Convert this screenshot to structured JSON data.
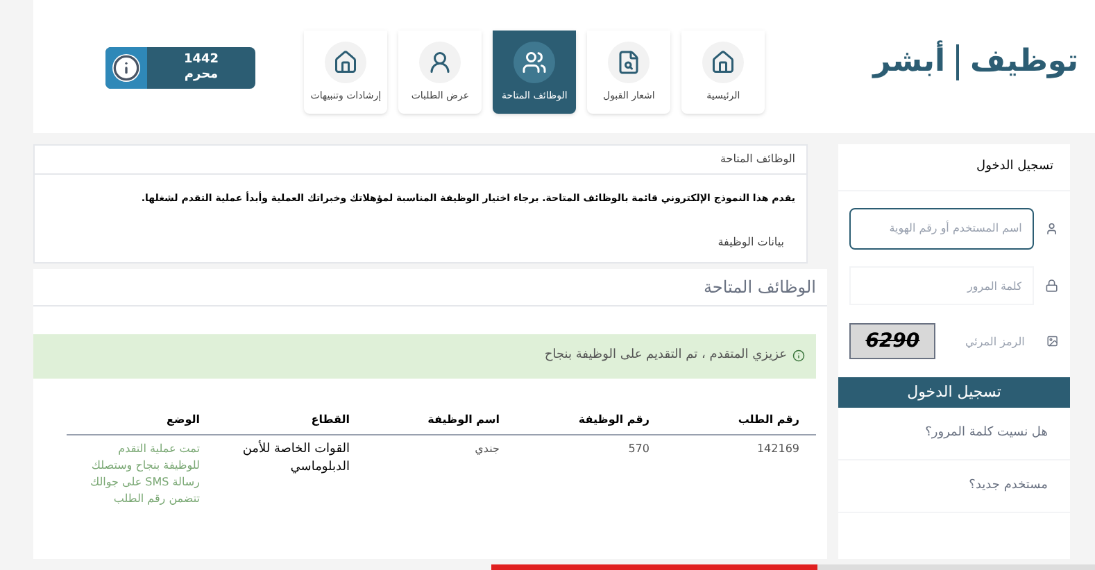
{
  "logo": {
    "text_left": "أبشر",
    "text_right": "توظيف"
  },
  "nav": [
    {
      "label": "الرئيسية",
      "selected": false
    },
    {
      "label": "اشعار القبول",
      "selected": false
    },
    {
      "label": "الوظائف المتاحة",
      "selected": true
    },
    {
      "label": "عرض الطلبات",
      "selected": false
    },
    {
      "label": "إرشادات وتنبيهات",
      "selected": false
    }
  ],
  "hijri_date": {
    "year": "1442",
    "month": "محرم"
  },
  "intro_panel": {
    "title": "الوظائف المتاحة",
    "text": "يقدم هذا النموذج الإلكتروني قائمة بالوظائف المتاحة. برجاء اختيار الوظيفة المناسبة لمؤهلاتك وخبراتك العملية وأبدأ عملية التقدم لشغلها.",
    "section": "بيانات الوظيفة"
  },
  "jobs_panel": {
    "title": "الوظائف المتاحة",
    "alert": "عزيزي المتقدم ، تم التقديم على الوظيفة بنجاح"
  },
  "table": {
    "columns": [
      "رقم الطلب",
      "رقم الوظيفة",
      "اسم الوظيفة",
      "القطاع",
      "الوضع"
    ],
    "rows": [
      [
        "142169",
        "570",
        "جندي",
        "القوات الخاصة للأمن الدبلوماسي",
        "تمت عملية التقدم للوظيفة بنجاح وستصلك رسالة SMS على جوالك تتضمن رقم الطلب"
      ]
    ]
  },
  "login": {
    "title": "تسجيل الدخول",
    "username_placeholder": "اسم المستخدم أو رقم الهوية",
    "password_placeholder": "كلمة المرور",
    "captcha_placeholder": "الرمز المرئي",
    "captcha_text": "6290",
    "button": "تسجيل الدخول",
    "links": [
      "هل نسيت كلمة المرور؟",
      "مستخدم جديد؟"
    ]
  },
  "video_progress": {
    "level": 0.54
  }
}
